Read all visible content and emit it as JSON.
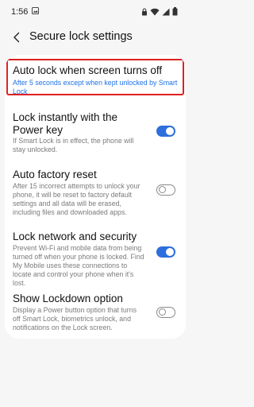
{
  "status_bar": {
    "time": "1:56",
    "left_icon": "gallery-notification-icon",
    "right_icons": [
      "lock-icon",
      "wifi-icon",
      "signal-icon",
      "battery-icon"
    ]
  },
  "header": {
    "back_icon": "back-arrow-icon",
    "title": "Secure lock settings"
  },
  "settings": [
    {
      "title": "Auto lock when screen turns off",
      "description": "After 5 seconds except when kept unlocked by Smart Lock",
      "description_color": "#1e73e6",
      "highlighted": true
    },
    {
      "title": "Lock instantly with the Power key",
      "description": "If Smart Lock is in effect, the phone will stay unlocked.",
      "toggle": true
    },
    {
      "title": "Auto factory reset",
      "description": "After 15 incorrect attempts to unlock your phone, it will be reset to factory default settings and all data will be erased, including files and downloaded apps.",
      "toggle": false
    },
    {
      "title": "Lock network and security",
      "description": "Prevent Wi-Fi and mobile data from being turned off when your phone is locked. Find My Mobile uses these connections to locate and control your phone when it's lost.",
      "toggle": true
    },
    {
      "title": "Show Lockdown option",
      "description": "Display a Power button option that turns off Smart Lock, biometrics unlock, and notifications on the Lock screen.",
      "toggle": false
    }
  ],
  "colors": {
    "accent": "#2d6fdc",
    "highlight_border": "#e02020",
    "background": "#f6f6f6"
  }
}
